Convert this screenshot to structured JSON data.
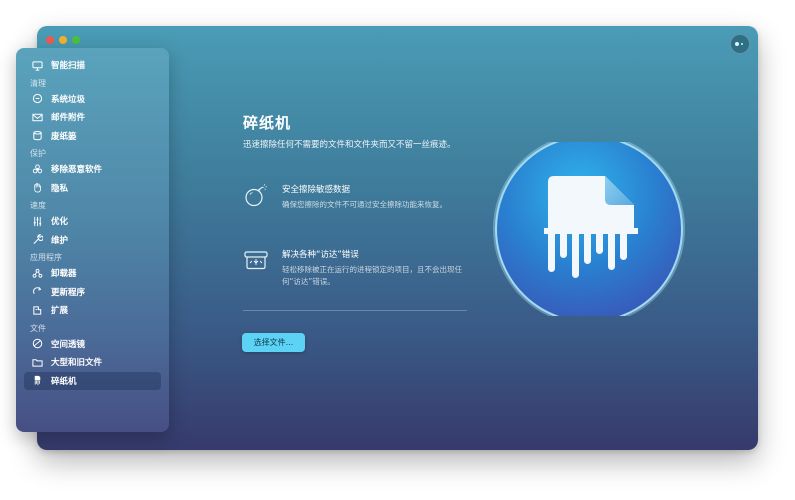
{
  "window": {
    "title": "",
    "traffic_lights": [
      "close",
      "minimize",
      "maximize"
    ]
  },
  "sidebar": {
    "top_item": {
      "label": "智能扫描",
      "icon": "monitor-icon"
    },
    "sections": [
      {
        "header": "清理",
        "items": [
          {
            "label": "系统垃圾",
            "icon": "trash-bin-icon"
          },
          {
            "label": "邮件附件",
            "icon": "envelope-icon"
          },
          {
            "label": "废纸篓",
            "icon": "bin-icon"
          }
        ]
      },
      {
        "header": "保护",
        "items": [
          {
            "label": "移除恶意软件",
            "icon": "biohazard-icon"
          },
          {
            "label": "隐私",
            "icon": "hand-icon"
          }
        ]
      },
      {
        "header": "速度",
        "items": [
          {
            "label": "优化",
            "icon": "sliders-icon"
          },
          {
            "label": "维护",
            "icon": "wrench-icon"
          }
        ]
      },
      {
        "header": "应用程序",
        "items": [
          {
            "label": "卸载器",
            "icon": "uninstaller-icon"
          },
          {
            "label": "更新程序",
            "icon": "update-icon"
          },
          {
            "label": "扩展",
            "icon": "extension-icon"
          }
        ]
      },
      {
        "header": "文件",
        "items": [
          {
            "label": "空间透镜",
            "icon": "lens-icon"
          },
          {
            "label": "大型和旧文件",
            "icon": "folder-icon"
          },
          {
            "label": "碎纸机",
            "icon": "shredder-icon",
            "active": true
          }
        ]
      }
    ]
  },
  "main": {
    "title": "碎纸机",
    "description": "迅速擦除任何不需要的文件和文件夹而又不留一丝痕迹。",
    "features": [
      {
        "title": "安全擦除敏感数据",
        "text": "确保您擦除的文件不可通过安全擦除功能来恢复。",
        "icon": "bomb-icon"
      },
      {
        "title": "解决各种“访达”错误",
        "text": "轻松移除被正在运行的进程锁定的项目，且不会出现任何“访达”错误。",
        "icon": "box-icon"
      }
    ],
    "choose_button": "选择文件..."
  },
  "colors": {
    "accent": "#5cd3f5",
    "hero_circle": "#2f8fd8"
  }
}
